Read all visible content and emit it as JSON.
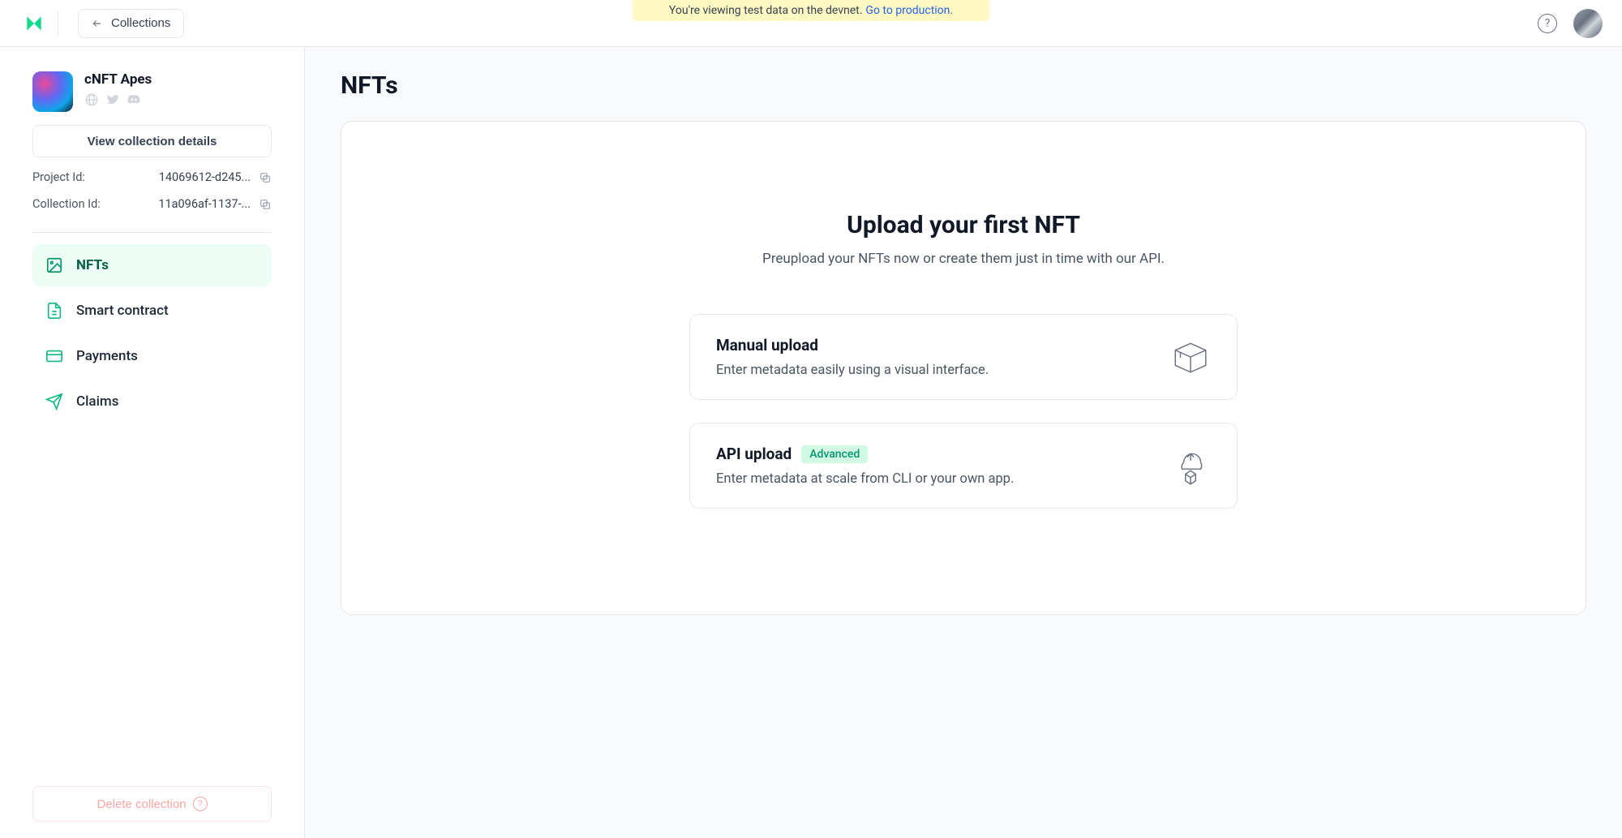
{
  "banner": {
    "text": "You're viewing test data on the devnet.",
    "link_text": "Go to production."
  },
  "topbar": {
    "back_label": "Collections"
  },
  "sidebar": {
    "collection_name": "cNFT Apes",
    "view_details_label": "View collection details",
    "meta": {
      "project_label": "Project Id:",
      "project_value": "14069612-d245...",
      "collection_label": "Collection Id:",
      "collection_value": "11a096af-1137-..."
    },
    "nav": {
      "nfts": "NFTs",
      "smart_contract": "Smart contract",
      "payments": "Payments",
      "claims": "Claims"
    },
    "delete_label": "Delete collection"
  },
  "main": {
    "page_title": "NFTs",
    "hero_title": "Upload your first NFT",
    "hero_sub": "Preupload your NFTs now or create them just in time with our API.",
    "options": {
      "manual": {
        "title": "Manual upload",
        "desc": "Enter metadata easily using a visual interface."
      },
      "api": {
        "title": "API upload",
        "badge": "Advanced",
        "desc": "Enter metadata at scale from CLI or your own app."
      }
    }
  }
}
